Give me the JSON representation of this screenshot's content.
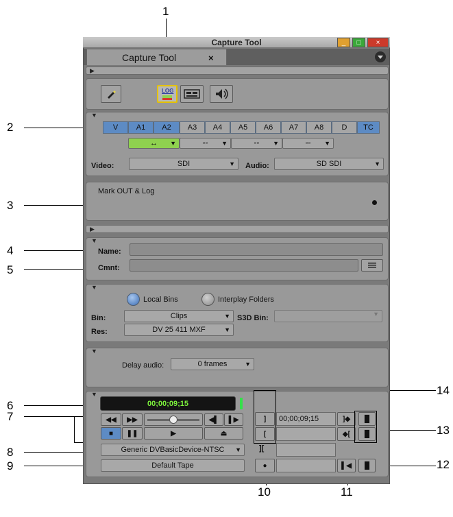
{
  "window": {
    "title": "Capture Tool",
    "tab_label": "Capture Tool",
    "tab_close": "×",
    "buttons": {
      "minimize": "_",
      "maximize": "□",
      "close": "×"
    }
  },
  "callouts": [
    "1",
    "2",
    "3",
    "4",
    "5",
    "6",
    "7",
    "8",
    "9",
    "10",
    "11",
    "12",
    "13",
    "14"
  ],
  "toolbar": {
    "log_label": "LOG"
  },
  "tracks": {
    "items": [
      {
        "label": "V",
        "enabled": true
      },
      {
        "label": "A1",
        "enabled": true
      },
      {
        "label": "A2",
        "enabled": true
      },
      {
        "label": "A3",
        "enabled": false
      },
      {
        "label": "A4",
        "enabled": false
      },
      {
        "label": "A5",
        "enabled": false
      },
      {
        "label": "A6",
        "enabled": false
      },
      {
        "label": "A7",
        "enabled": false
      },
      {
        "label": "A8",
        "enabled": false
      },
      {
        "label": "D",
        "enabled": false
      },
      {
        "label": "TC",
        "enabled": true
      }
    ],
    "link_groups": [
      "↔",
      "◦◦",
      "◦◦",
      "◦◦"
    ],
    "video_label": "Video:",
    "video_value": "SDI",
    "audio_label": "Audio:",
    "audio_value": "SD SDI"
  },
  "status": {
    "message": "Mark OUT & Log"
  },
  "clip": {
    "name_label": "Name:",
    "name_value": "",
    "cmnt_label": "Cmnt:",
    "cmnt_value": ""
  },
  "bins": {
    "local_label": "Local Bins",
    "interplay_label": "Interplay Folders",
    "bin_label": "Bin:",
    "bin_value": "Clips",
    "s3d_label": "S3D Bin:",
    "res_label": "Res:",
    "res_value": "DV 25 411 MXF"
  },
  "delay": {
    "label": "Delay audio:",
    "value": "0 frames"
  },
  "deck": {
    "timecode": "00;00;09;15",
    "device": "Generic DVBasicDevice-NTSC",
    "tape": "Default Tape",
    "mark_in_tc": "00;00;09;15",
    "colors": {
      "timecode": "#7cf23c",
      "indicator": "#35e04a",
      "accent": "#5d8bc4",
      "log_green": "#8fd14f"
    }
  }
}
